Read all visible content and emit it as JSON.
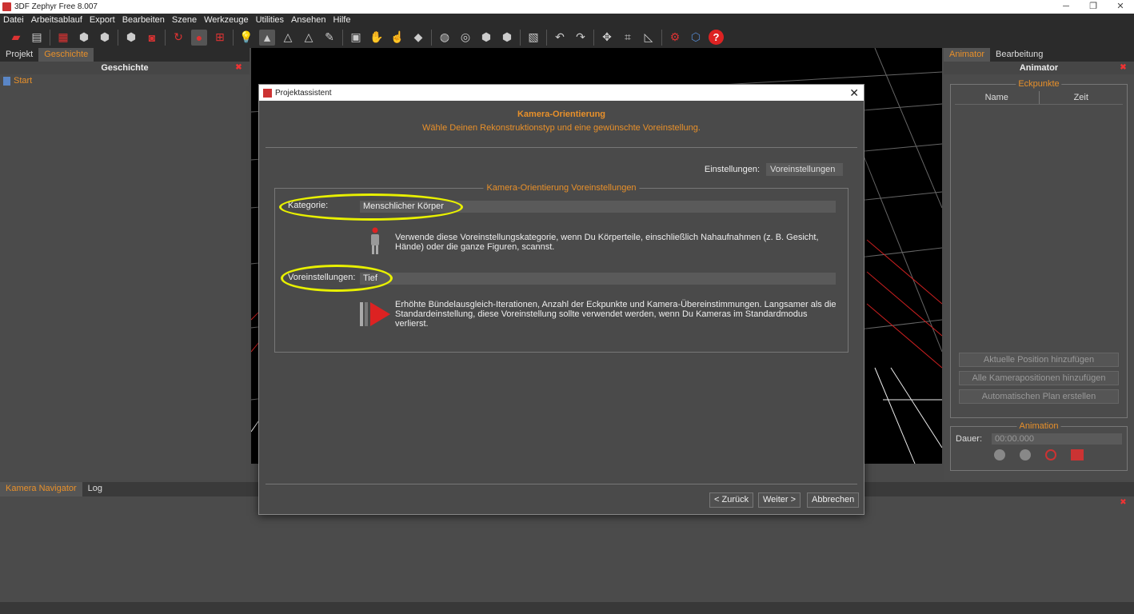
{
  "window": {
    "title": "3DF Zephyr Free 8.007",
    "minimize": "─",
    "restore": "❐",
    "close": "✕"
  },
  "menu": [
    "Datei",
    "Arbeitsablauf",
    "Export",
    "Bearbeiten",
    "Szene",
    "Werkzeuge",
    "Utilities",
    "Ansehen",
    "Hilfe"
  ],
  "left_panel": {
    "tabs": [
      "Projekt",
      "Geschichte"
    ],
    "title": "Geschichte",
    "items": [
      "Start"
    ]
  },
  "right_panel": {
    "tabs": [
      "Animator",
      "Bearbeitung"
    ],
    "title": "Animator",
    "keypoints_group": "Eckpunkte",
    "columns": [
      "Name",
      "Zeit"
    ],
    "buttons": [
      "Aktuelle Position hinzufügen",
      "Alle Kamerapositionen hinzufügen",
      "Automatischen Plan erstellen"
    ],
    "animation_group": "Animation",
    "duration_label": "Dauer:",
    "duration_value": "00:00.000"
  },
  "bottom_panel": {
    "tabs": [
      "Kamera Navigator",
      "Log"
    ]
  },
  "dialog": {
    "title": "Projektassistent",
    "heading": "Kamera-Orientierung",
    "subheading": "Wähle Deinen Rekonstruktionstyp und eine gewünschte Voreinstellung.",
    "settings_label": "Einstellungen:",
    "settings_value": "Voreinstellungen",
    "group_title": "Kamera-Orientierung Voreinstellungen",
    "category_label": "Kategorie:",
    "category_value": "Menschlicher Körper",
    "category_desc": "Verwende diese Voreinstellungskategorie, wenn Du Körperteile, einschließlich Nahaufnahmen (z. B. Gesicht, Hände) oder die ganze Figuren, scannst.",
    "preset_label": "Voreinstellungen:",
    "preset_value": "Tief",
    "preset_desc": "Erhöhte Bündelausgleich-Iterationen, Anzahl der Eckpunkte und Kamera-Übereinstimmungen. Langsamer als die Standardeinstellung, diese Voreinstellung sollte verwendet werden, wenn Du Kameras im Standardmodus verlierst.",
    "back": "< Zurück",
    "next": "Weiter >",
    "cancel": "Abbrechen"
  },
  "colors": {
    "accent": "#e8902a",
    "highlight": "#e8f000",
    "grid_red": "#cc2020"
  }
}
